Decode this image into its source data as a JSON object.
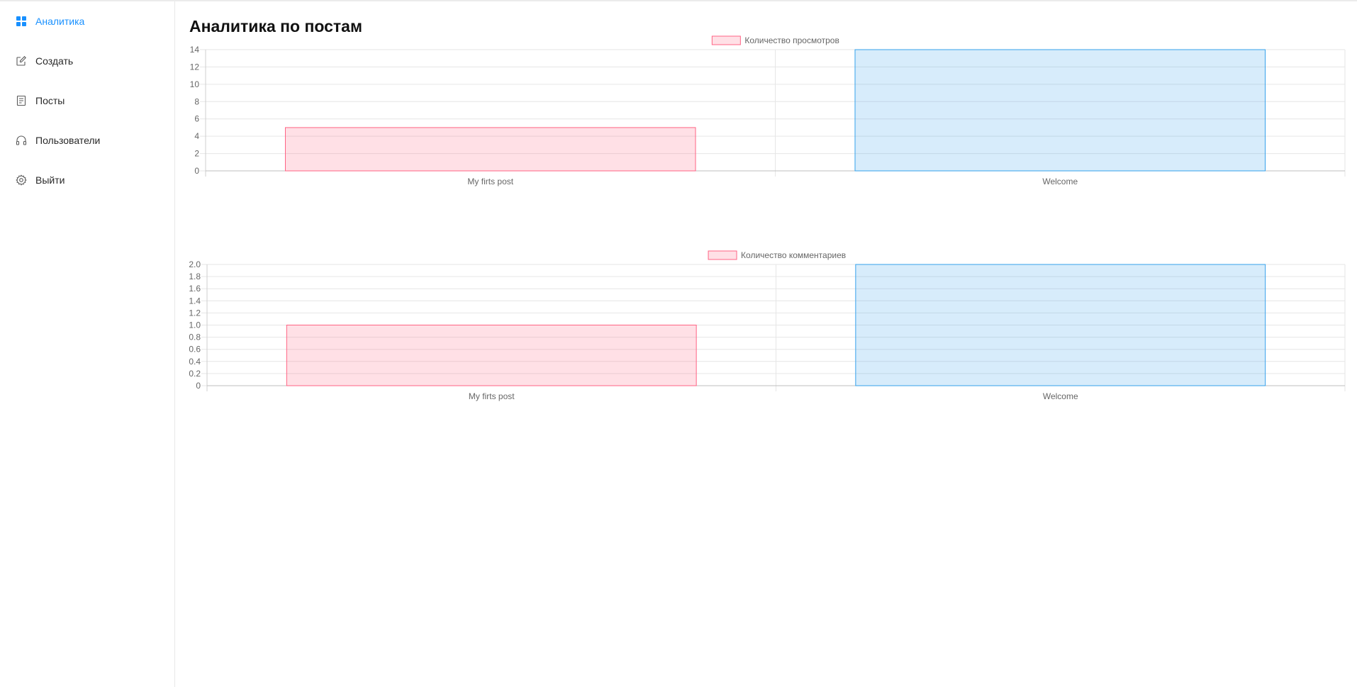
{
  "sidebar": {
    "items": [
      {
        "label": "Аналитика",
        "icon": "dashboard-icon",
        "active": true
      },
      {
        "label": "Создать",
        "icon": "edit-icon",
        "active": false
      },
      {
        "label": "Посты",
        "icon": "file-text-icon",
        "active": false
      },
      {
        "label": "Пользователи",
        "icon": "headphones-icon",
        "active": false
      },
      {
        "label": "Выйти",
        "icon": "gear-icon",
        "active": false
      }
    ],
    "active_color": "#1890ff"
  },
  "page": {
    "title": "Аналитика по постам"
  },
  "chart_data": [
    {
      "type": "bar",
      "title": "",
      "xlabel": "",
      "ylabel": "",
      "categories": [
        "My firts post",
        "Welcome"
      ],
      "series": [
        {
          "name": "Количество просмотров",
          "values": [
            5,
            14
          ]
        }
      ],
      "bar_colors": [
        {
          "fill": "rgba(255,99,132,0.2)",
          "stroke": "#ff6384"
        },
        {
          "fill": "rgba(54,162,235,0.2)",
          "stroke": "#36a2eb"
        }
      ],
      "ylim": [
        0,
        14
      ],
      "yticks": [
        "0",
        "2",
        "4",
        "6",
        "8",
        "10",
        "12",
        "14"
      ],
      "grid": true,
      "legend": "top"
    },
    {
      "type": "bar",
      "title": "",
      "xlabel": "",
      "ylabel": "",
      "categories": [
        "My firts post",
        "Welcome"
      ],
      "series": [
        {
          "name": "Количество комментариев",
          "values": [
            1,
            2
          ]
        }
      ],
      "bar_colors": [
        {
          "fill": "rgba(255,99,132,0.2)",
          "stroke": "#ff6384"
        },
        {
          "fill": "rgba(54,162,235,0.2)",
          "stroke": "#36a2eb"
        }
      ],
      "ylim": [
        0,
        2
      ],
      "yticks": [
        "0",
        "0.2",
        "0.4",
        "0.6",
        "0.8",
        "1.0",
        "1.2",
        "1.4",
        "1.6",
        "1.8",
        "2.0"
      ],
      "grid": true,
      "legend": "top"
    }
  ]
}
